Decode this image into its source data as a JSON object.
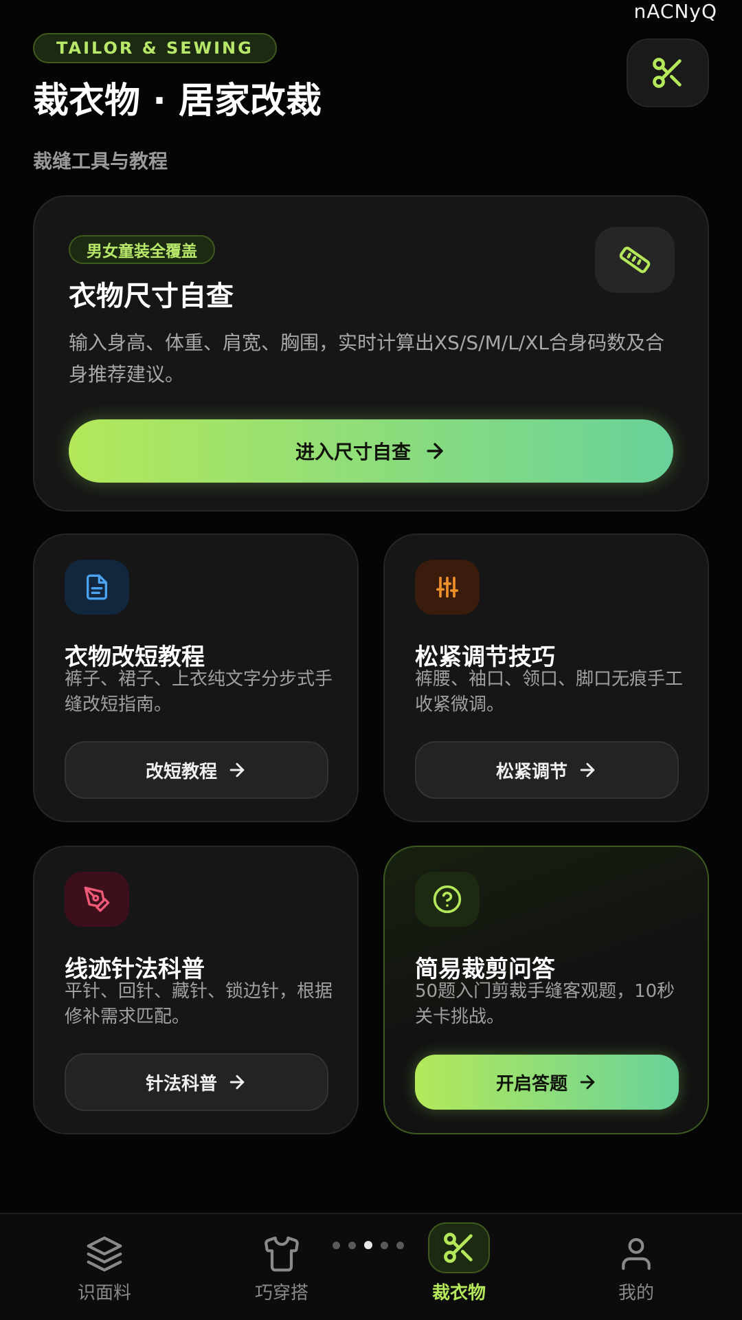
{
  "top_id": "nACNyQ",
  "header": {
    "tag": "TAILOR & SEWING",
    "title": "裁衣物 · 居家改裁",
    "subtitle": "裁缝工具与教程",
    "action_icon": "scissors-icon"
  },
  "hero": {
    "badge": "男女童装全覆盖",
    "title": "衣物尺寸自查",
    "description": "输入身高、体重、肩宽、胸围，实时计算出XS/S/M/L/XL合身码数及合身推荐建议。",
    "icon": "ruler-icon",
    "button_label": "进入尺寸自查"
  },
  "cards": [
    {
      "title": "衣物改短教程",
      "description": "裤子、裙子、上衣纯文字分步式手缝改短指南。",
      "button_label": "改短教程",
      "icon": "document-icon",
      "accent": "#4aa3f0"
    },
    {
      "title": "松紧调节技巧",
      "description": "裤腰、袖口、领口、脚口无痕手工收紧微调。",
      "button_label": "松紧调节",
      "icon": "sliders-icon",
      "accent": "#f0902a"
    },
    {
      "title": "线迹针法科普",
      "description": "平针、回针、藏针、锁边针，根据修补需求匹配。",
      "button_label": "针法科普",
      "icon": "pen-nib-icon",
      "accent": "#f05a78"
    },
    {
      "title": "简易裁剪问答",
      "description": "50题入门剪裁手缝客观题，10秒关卡挑战。",
      "button_label": "开启答题",
      "icon": "question-circle-icon",
      "accent": "#b4e85a"
    }
  ],
  "nav": {
    "items": [
      {
        "label": "识面料",
        "icon": "layers-icon"
      },
      {
        "label": "巧穿搭",
        "icon": "tshirt-icon"
      },
      {
        "label": "裁衣物",
        "icon": "scissors-icon",
        "active": true
      },
      {
        "label": "我的",
        "icon": "user-icon"
      }
    ],
    "page_dots": 5,
    "active_dot": 3
  },
  "colors": {
    "background": "#050505",
    "accent": "#b4e85a",
    "accent_gradient_end": "#68d29a"
  }
}
